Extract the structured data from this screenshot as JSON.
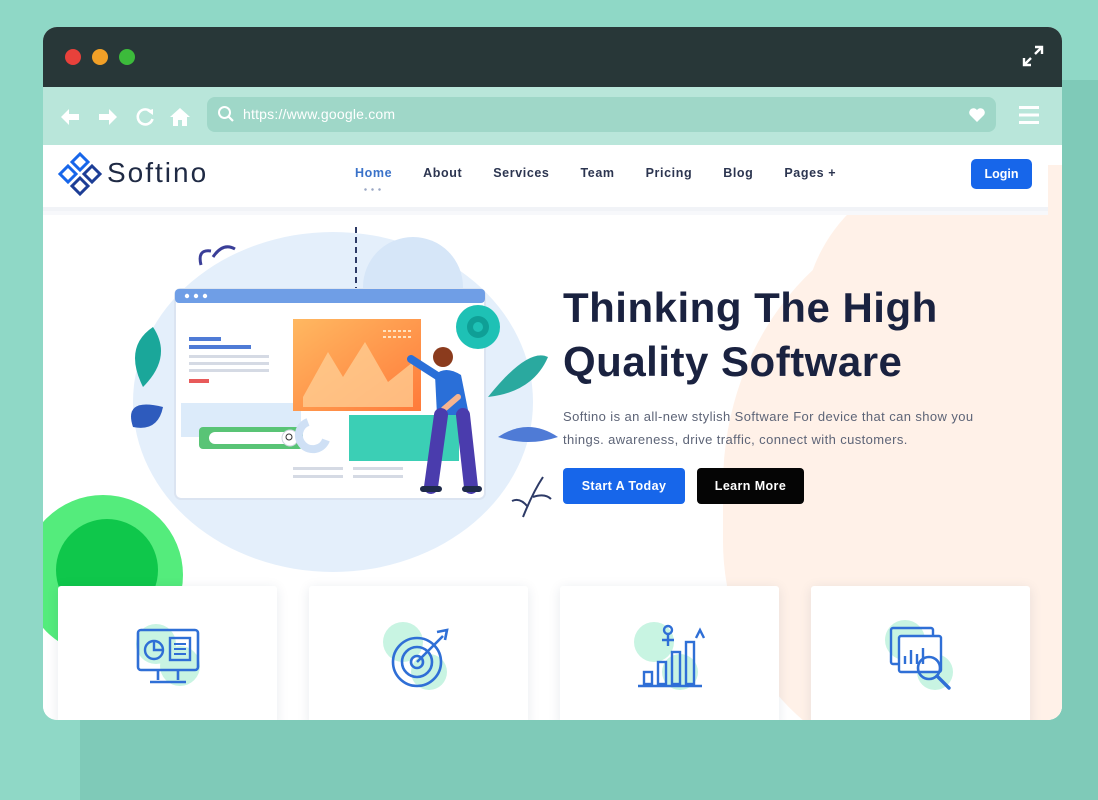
{
  "browser": {
    "url": "https://www.google.com",
    "colors": {
      "frame": "#283738",
      "toolbar": "#b9e6da",
      "urlbar": "#9fd7c8",
      "background": "#8fd8c6"
    },
    "icons": [
      "back-arrow-icon",
      "forward-arrow-icon",
      "refresh-icon",
      "home-icon",
      "search-icon",
      "heart-icon",
      "hamburger-menu-icon",
      "expand-icon"
    ]
  },
  "site": {
    "logo_text": "Softino",
    "nav": {
      "items": [
        {
          "label": "Home",
          "active": true
        },
        {
          "label": "About"
        },
        {
          "label": "Services"
        },
        {
          "label": "Team"
        },
        {
          "label": "Pricing"
        },
        {
          "label": "Blog"
        },
        {
          "label": "Pages +"
        }
      ],
      "login_label": "Login"
    },
    "hero": {
      "title_line1": "Thinking The High",
      "title_line2": "Quality Software",
      "description": "Softino is an all-new stylish Software For device that can show you things. awareness, drive traffic, connect with customers.",
      "primary_button": "Start A Today",
      "secondary_button": "Learn More"
    },
    "feature_cards": [
      {
        "icon": "monitor-dashboard-icon"
      },
      {
        "icon": "target-icon"
      },
      {
        "icon": "growth-chart-icon"
      },
      {
        "icon": "analytics-search-icon"
      }
    ],
    "colors": {
      "accent": "#1766ea",
      "title": "#1a2240",
      "green": "#0fc74b",
      "peach": "#fff1e8"
    }
  }
}
